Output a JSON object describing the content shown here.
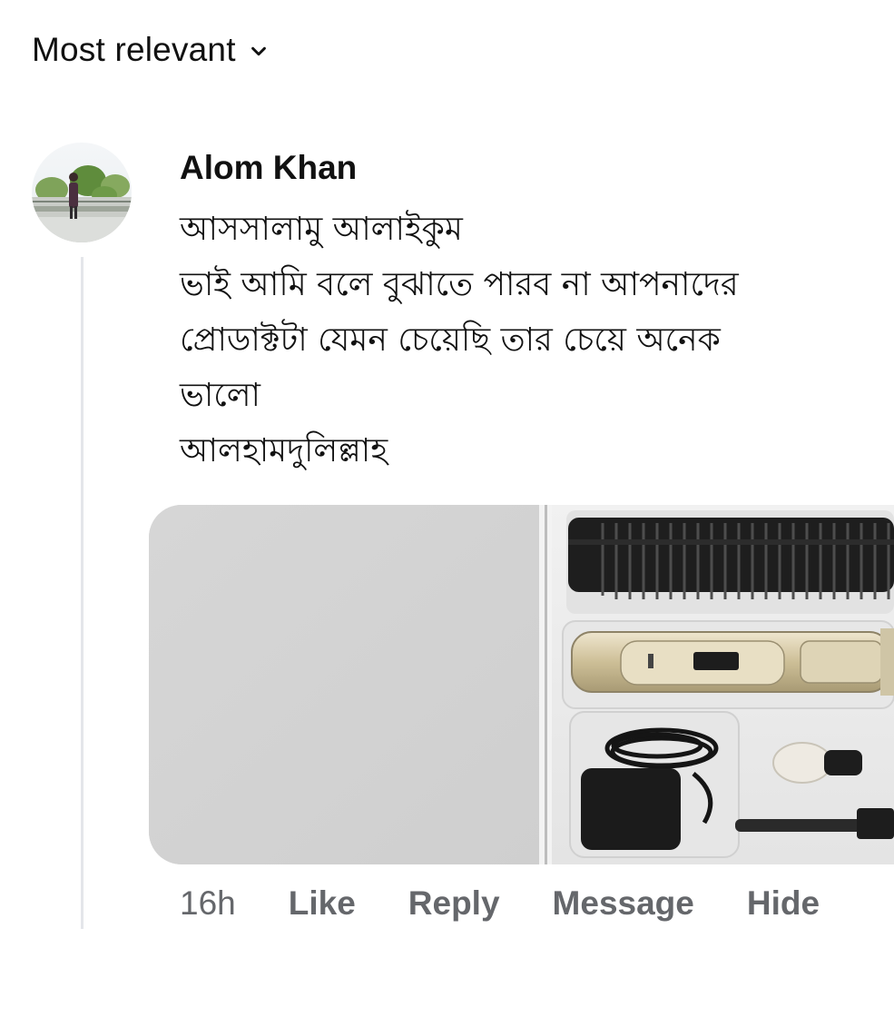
{
  "sort": {
    "label": "Most relevant",
    "icon": "chevron-down-icon"
  },
  "comment": {
    "author": "Alom Khan",
    "lines": [
      "আসসালামু আলাইকুম",
      "ভাই আমি বলে বুঝাতে পারব না আপনাদের",
      "প্রোডাক্টটা যেমন চেয়েছি তার চেয়ে অনেক",
      "ভালো",
      "আলহামদুলিল্লাহ"
    ],
    "attachment": "photo-hair-clipper-kit",
    "time": "16h",
    "actions": {
      "like": "Like",
      "reply": "Reply",
      "message": "Message",
      "hide": "Hide"
    }
  },
  "colors": {
    "text": "#111111",
    "meta": "#65676b",
    "thread_line": "#e4e6ea"
  }
}
